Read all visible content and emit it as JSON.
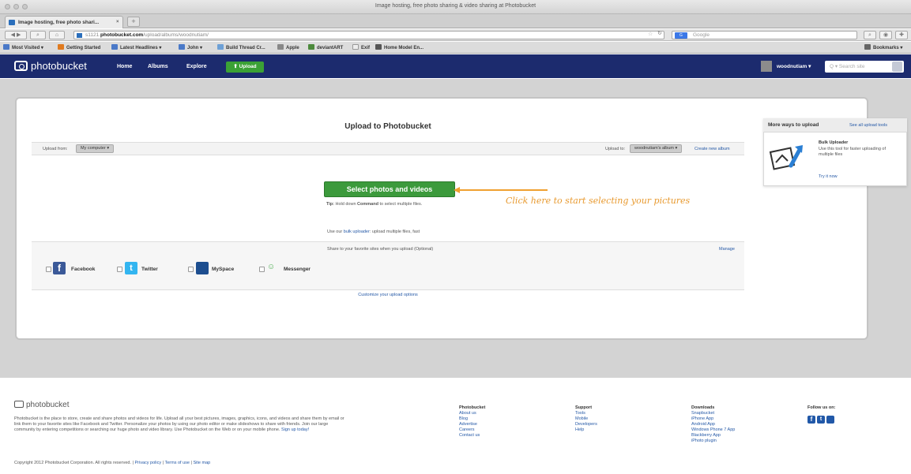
{
  "browser": {
    "window_title": "Image hosting, free photo sharing & video sharing at Photobucket",
    "tab_title": "Image hosting, free photo shari...",
    "tab_close": "×",
    "new_tab": "+",
    "nav_back": "◀",
    "nav_forward": "▶",
    "url_prefix": "s1121.",
    "url_domain": "photobucket.com",
    "url_path": "/upload/albums/woodnutiam/",
    "search_placeholder": "Google",
    "search_engine": "G",
    "bookmarks": [
      "Most Visited ▾",
      "Getting Started",
      "Latest Headlines ▾",
      "John ▾",
      "Build Thread Cr...",
      "Apple",
      "deviantART",
      "Exif",
      "Home Model En..."
    ],
    "bookmarks_menu": "Bookmarks ▾"
  },
  "site": {
    "logo": "photobucket",
    "nav": [
      "Home",
      "Albums",
      "Explore"
    ],
    "upload_label": "⬆ Upload",
    "username": "woodnutiam ▾",
    "search_placeholder": "Q ▾ Search site"
  },
  "upload": {
    "title": "Upload to Photobucket",
    "upload_from_label": "Upload from:",
    "upload_from_value": "My computer ▾",
    "upload_to_label": "Upload to:",
    "upload_to_value": "woodnutiam's album ▾",
    "create_album": "Create new album",
    "select_button": "Select photos and videos",
    "annotation": "Click here to start selecting your pictures",
    "tip_label": "Tip:",
    "tip_pre": "Hold down",
    "tip_key": "Command",
    "tip_post": "to select multiple files.",
    "bulk_pre": "Use our",
    "bulk_link": "bulk uploader",
    "bulk_post": ": upload multiple files, fast",
    "share_text": "Share to your favorite sites when you upload (Optional)",
    "manage": "Manage",
    "share_sites": [
      {
        "name": "Facebook",
        "color": "#3b5998"
      },
      {
        "name": "Twitter",
        "color": "#33ccff"
      },
      {
        "name": "MySpace",
        "color": "#1d4e8f"
      },
      {
        "name": "Messenger",
        "color": "#4caf50"
      }
    ],
    "customize": "Customize your upload options"
  },
  "sidebar": {
    "title": "More ways to upload",
    "see_all": "See all upload tools",
    "bulk_title": "Bulk Uploader",
    "bulk_desc": "Use this tool for faster uploading of multiple files",
    "try_now": "Try it now"
  },
  "footer": {
    "logo": "photobucket",
    "description": "Photobucket is the place to store, create and share photos and videos for life. Upload all your best pictures, images, graphics, icons, and videos and share them by email or link them to your favorite sites like Facebook and Twitter. Personalize your photos by using our photo editor or make slideshows to share with friends. Join our large community by entering competitions or searching our huge photo and video library. Use Photobucket on the Web or on your mobile phone.",
    "signup": "Sign up today!",
    "copyright": "Copyright 2012 Photobucket Corporation. All rights reserved.",
    "legal_links": [
      "Privacy policy",
      "Terms of use",
      "Site map"
    ],
    "columns": [
      {
        "title": "Photobucket",
        "items": [
          "About us",
          "Blog",
          "Advertise",
          "Careers",
          "Contact us"
        ]
      },
      {
        "title": "Support",
        "items": [
          "Tools",
          "Mobile",
          "Developers",
          "Help"
        ]
      },
      {
        "title": "Downloads",
        "items": [
          "Snapbucket",
          "iPhone App",
          "Android App",
          "Windows Phone 7 App",
          "Blackberry App",
          "iPhoto plugin"
        ]
      }
    ],
    "follow": "Follow us on:"
  },
  "colors": {
    "nav_bg": "#1c2b6e",
    "upload_green": "#3c9a3c",
    "annotation": "#e89a30",
    "link": "#2458a6"
  }
}
